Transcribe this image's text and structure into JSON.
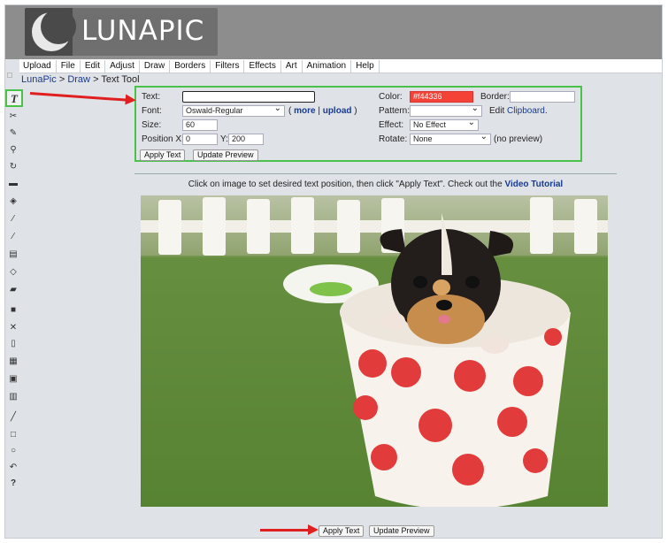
{
  "logo": {
    "text": "LUNAPIC"
  },
  "menu": [
    "Upload",
    "File",
    "Edit",
    "Adjust",
    "Draw",
    "Borders",
    "Filters",
    "Effects",
    "Art",
    "Animation",
    "Help"
  ],
  "breadcrumb": {
    "home": "LunaPic",
    "section": "Draw",
    "tool": "Text Tool",
    "sep": ">"
  },
  "tools": [
    "text-icon",
    "scissors-icon",
    "pencil-icon",
    "zoom-icon",
    "rotate-icon",
    "crop-icon",
    "paint-bucket-icon",
    "eyedropper-icon",
    "brush-icon",
    "image-icon",
    "eraser-icon",
    "open-folder-icon",
    "save-icon",
    "close-icon",
    "new-file-icon",
    "print-icon",
    "copy-icon",
    "paste-icon",
    "line-icon",
    "rectangle-icon",
    "circle-icon",
    "undo-icon",
    "help-icon"
  ],
  "form": {
    "text_label": "Text:",
    "text_value": "",
    "font_label": "Font:",
    "font_value": "Oswald-Regular",
    "more_link": "more",
    "upload_link": "upload",
    "size_label": "Size:",
    "size_value": "60",
    "posx_label": "Position X:",
    "posx_value": "0",
    "posy_label": "Y:",
    "posy_value": "200",
    "apply_button": "Apply Text",
    "preview_button": "Update Preview",
    "color_label": "Color:",
    "color_value": "#f44336",
    "border_label": "Border:",
    "border_value": "",
    "pattern_label": "Pattern:",
    "pattern_value": "",
    "edit_text": "Edit",
    "clipboard_link": "Clipboard",
    "effect_label": "Effect:",
    "effect_value": "No Effect",
    "rotate_label": "Rotate:",
    "rotate_value": "None",
    "no_preview": "(no preview)"
  },
  "hint": {
    "text": "Click on image to set desired text position, then click \"Apply Text\". Check out the",
    "link": "Video Tutorial"
  },
  "bottom": {
    "apply_button": "Apply Text",
    "preview_button": "Update Preview"
  },
  "colors": {
    "accent_green": "#4ac24a",
    "arrow_red": "#e02020",
    "color_swatch": "#f44336"
  }
}
